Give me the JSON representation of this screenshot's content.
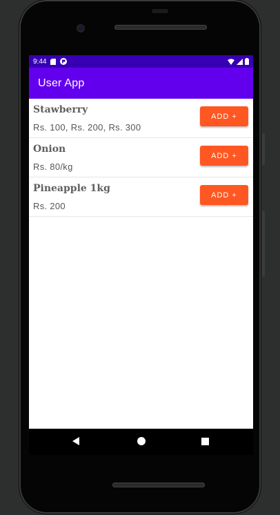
{
  "status_bar": {
    "time": "9:44",
    "left_icons": [
      "sd-card-icon",
      "app-notification-icon"
    ],
    "right_icons": [
      "wifi-icon",
      "signal-icon",
      "battery-icon"
    ]
  },
  "app_bar": {
    "title": "User App"
  },
  "products": [
    {
      "name": "Stawberry",
      "price": "Rs.  100,  Rs.  200,  Rs.  300",
      "button": "ADD +"
    },
    {
      "name": "Onion",
      "price": "Rs. 80/kg",
      "button": "ADD +"
    },
    {
      "name": "Pineapple 1kg",
      "price": "Rs.  200",
      "button": "ADD +"
    }
  ],
  "nav_bar": {
    "icons": [
      "back-icon",
      "home-icon",
      "recents-icon"
    ]
  },
  "colors": {
    "status_bar": "#3700b3",
    "app_bar": "#6200ee",
    "accent": "#ff5722"
  }
}
